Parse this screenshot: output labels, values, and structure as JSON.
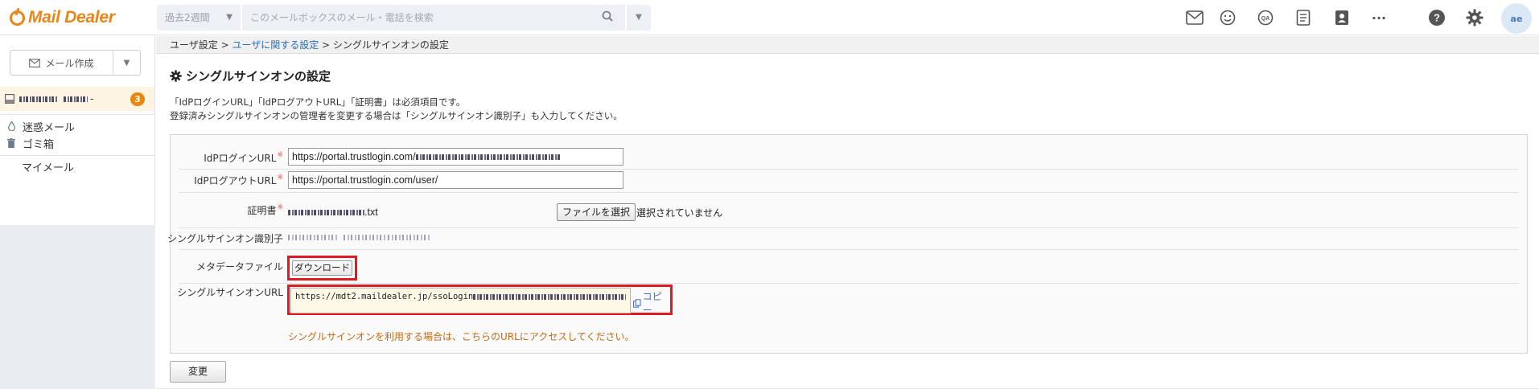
{
  "header": {
    "logo_text": "Mail Dealer",
    "period_select": "過去2週間",
    "search_placeholder": "このメールボックスのメール・電話を検索",
    "more_label": "···",
    "avatar_initials": "ae"
  },
  "sidebar": {
    "compose_label": "メール作成",
    "mailbox_badge": "3",
    "items": [
      {
        "label": "迷惑メール",
        "icon": "spam-drop-icon"
      },
      {
        "label": "ゴミ箱",
        "icon": "trash-icon"
      },
      {
        "label": "マイメール"
      }
    ]
  },
  "breadcrumb": {
    "root": "ユーザ設定",
    "sep1": " > ",
    "link": "ユーザに関する設定",
    "sep2": " > ",
    "current": "シングルサインオンの設定"
  },
  "page": {
    "title": "シングルサインオンの設定",
    "notice_line1": "「IdPログインURL」「IdPログアウトURL」「証明書」は必須項目です。",
    "notice_line2": "登録済みシングルサインオンの管理者を変更する場合は「シングルサインオン識別子」も入力してください。"
  },
  "form": {
    "idp_login_label": "IdPログインURL",
    "idp_login_value": "https://portal.trustlogin.com/",
    "idp_logout_label": "IdPログアウトURL",
    "idp_logout_value": "https://portal.trustlogin.com/user/",
    "cert_label": "証明書",
    "cert_filename_suffix": ".txt",
    "file_button": "ファイルを選択",
    "file_status": "選択されていません",
    "sso_id_label": "シングルサインオン識別子",
    "metadata_label": "メタデータファイル",
    "download_button": "ダウンロード",
    "sso_url_label": "シングルサインオンURL",
    "sso_url_value": "https://mdt2.maildealer.jp/ssoLogin",
    "copy_label": "コピー",
    "sso_hint": "シングルサインオンを利用する場合は、こちらのURLにアクセスしてください。",
    "required_mark": "※",
    "submit_button": "変更"
  },
  "colors": {
    "brand_orange": "#e9861a",
    "highlight_red": "#e01a23",
    "link_blue": "#2a6fb5",
    "hint_orange": "#c26b16"
  }
}
